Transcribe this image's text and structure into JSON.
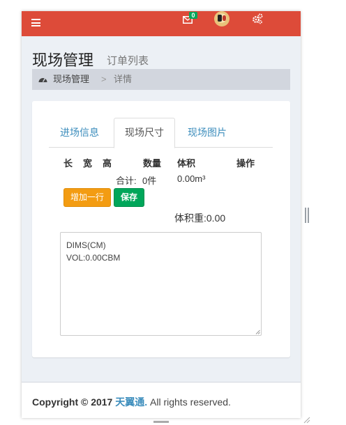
{
  "topbar": {
    "mail_badge": "0",
    "color": "#dd4b39"
  },
  "header": {
    "title": "现场管理",
    "subtitle": "订单列表"
  },
  "breadcrumb": {
    "home": "现场管理",
    "separator": ">",
    "current": "详情"
  },
  "tabs": [
    {
      "label": "进场信息",
      "active": false
    },
    {
      "label": "现场尺寸",
      "active": true
    },
    {
      "label": "现场图片",
      "active": false
    }
  ],
  "table": {
    "headers": {
      "length": "长",
      "width": "宽",
      "height": "高",
      "quantity": "数量",
      "volume": "体积",
      "action": "操作"
    },
    "total_label": "合计:",
    "total_quantity": "0件",
    "total_volume": "0.00m³"
  },
  "buttons": {
    "add_row": "增加一行",
    "save": "保存"
  },
  "volume_weight": "体积重:0.00",
  "textarea": {
    "line1": "DIMS(CM)",
    "line2": "VOL:0.00CBM"
  },
  "footer": {
    "copyright": "Copyright © 2017",
    "brand": "天翼通.",
    "rights": "All rights reserved."
  },
  "colors": {
    "accent": "#3c8dbc",
    "warning": "#f39c12",
    "success": "#00a65a"
  }
}
